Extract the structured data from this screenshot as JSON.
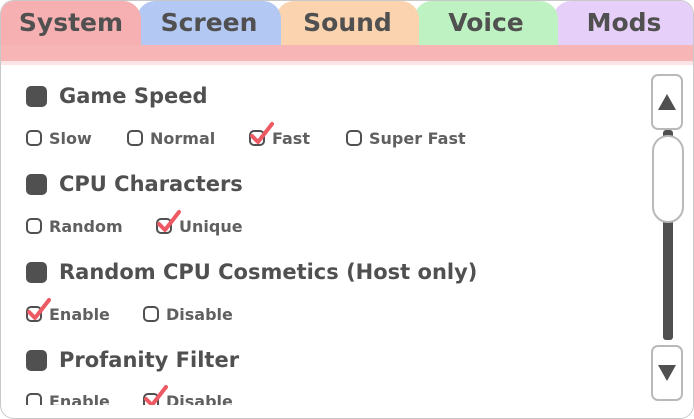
{
  "tabs": [
    {
      "label": "System",
      "color": "#f6b0b1",
      "active": true
    },
    {
      "label": "Screen",
      "color": "#b3c8f2",
      "active": false
    },
    {
      "label": "Sound",
      "color": "#fbd3ae",
      "active": false
    },
    {
      "label": "Voice",
      "color": "#bff2c2",
      "active": false
    },
    {
      "label": "Mods",
      "color": "#e6cff8",
      "active": false
    }
  ],
  "sections": [
    {
      "title": "Game Speed",
      "options": [
        {
          "label": "Slow",
          "checked": false
        },
        {
          "label": "Normal",
          "checked": false
        },
        {
          "label": "Fast",
          "checked": true
        },
        {
          "label": "Super Fast",
          "checked": false
        }
      ]
    },
    {
      "title": "CPU Characters",
      "options": [
        {
          "label": "Random",
          "checked": false
        },
        {
          "label": "Unique",
          "checked": true
        }
      ]
    },
    {
      "title": "Random CPU Cosmetics (Host only)",
      "options": [
        {
          "label": "Enable",
          "checked": true
        },
        {
          "label": "Disable",
          "checked": false
        }
      ]
    },
    {
      "title": "Profanity Filter",
      "options": [
        {
          "label": "Enable",
          "checked": false
        },
        {
          "label": "Disable",
          "checked": true
        }
      ]
    }
  ],
  "colors": {
    "accent": "#f7b5b6",
    "text": "#505050",
    "check": "#ee5a64"
  },
  "icons": {
    "scroll_up": "triangle-up-icon",
    "scroll_down": "triangle-down-icon",
    "checkmark": "checkmark-icon"
  }
}
